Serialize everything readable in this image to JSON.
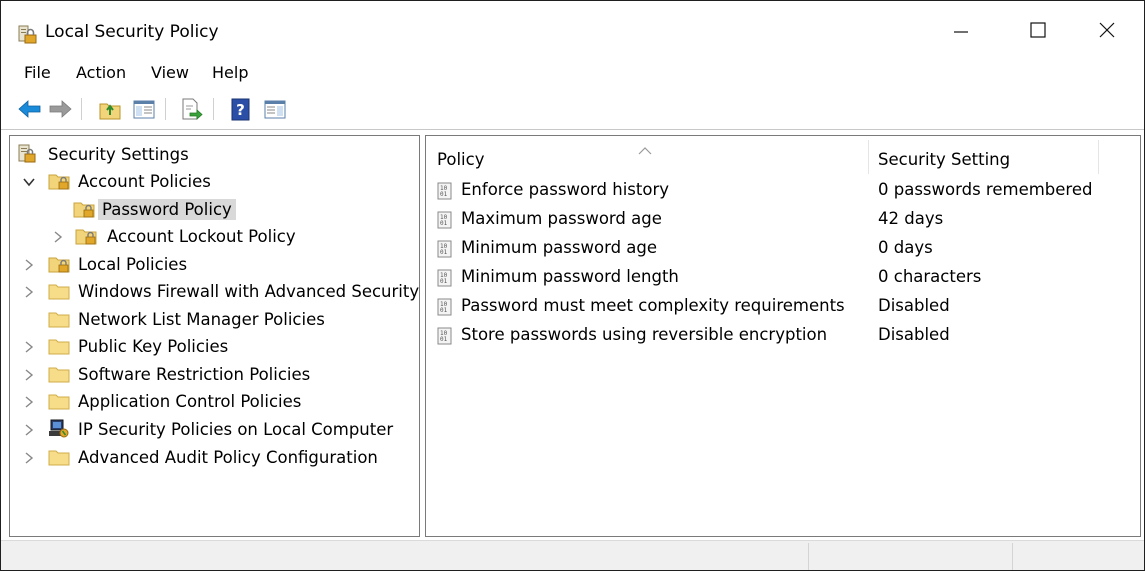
{
  "window": {
    "title": "Local Security Policy",
    "controls": {
      "minimize": "minimize",
      "maximize": "maximize",
      "close": "close"
    }
  },
  "menu": {
    "items": [
      {
        "label": "File"
      },
      {
        "label": "Action"
      },
      {
        "label": "View"
      },
      {
        "label": "Help"
      }
    ]
  },
  "toolbar": {
    "buttons": [
      {
        "icon": "back-arrow-icon"
      },
      {
        "icon": "forward-arrow-icon"
      },
      {
        "icon": "up-folder-icon"
      },
      {
        "icon": "show-hide-console-tree-icon"
      },
      {
        "icon": "export-list-icon"
      },
      {
        "icon": "help-icon"
      },
      {
        "icon": "show-hide-action-pane-icon"
      }
    ]
  },
  "tree": {
    "root": {
      "label": "Security Settings",
      "icon": "security-settings-icon"
    },
    "items": [
      {
        "label": "Account Policies",
        "icon": "policy-folder-icon",
        "expanded": true
      },
      {
        "label": "Password Policy",
        "icon": "policy-folder-icon",
        "selected": true
      },
      {
        "label": "Account Lockout Policy",
        "icon": "policy-folder-icon",
        "expanded": false
      },
      {
        "label": "Local Policies",
        "icon": "policy-folder-icon",
        "expanded": false
      },
      {
        "label": "Windows Firewall with Advanced Security",
        "icon": "folder-icon",
        "expanded": false
      },
      {
        "label": "Network List Manager Policies",
        "icon": "folder-icon"
      },
      {
        "label": "Public Key Policies",
        "icon": "folder-icon",
        "expanded": false
      },
      {
        "label": "Software Restriction Policies",
        "icon": "folder-icon",
        "expanded": false
      },
      {
        "label": "Application Control Policies",
        "icon": "folder-icon",
        "expanded": false
      },
      {
        "label": "IP Security Policies on Local Computer",
        "icon": "ip-security-icon",
        "expanded": false
      },
      {
        "label": "Advanced Audit Policy Configuration",
        "icon": "folder-icon",
        "expanded": false
      }
    ]
  },
  "list": {
    "columns": {
      "policy": "Policy",
      "setting": "Security Setting"
    },
    "rows": [
      {
        "policy": "Enforce password history",
        "setting": "0 passwords remembered"
      },
      {
        "policy": "Maximum password age",
        "setting": "42 days"
      },
      {
        "policy": "Minimum password age",
        "setting": "0 days"
      },
      {
        "policy": "Minimum password length",
        "setting": "0 characters"
      },
      {
        "policy": "Password must meet complexity requirements",
        "setting": "Disabled"
      },
      {
        "policy": "Store passwords using reversible encryption",
        "setting": "Disabled"
      }
    ]
  },
  "colors": {
    "selection": "#d9d9d9",
    "folder": "#f2d47a",
    "back_arrow": "#1a8bd8",
    "lock": "#d9a21b"
  }
}
